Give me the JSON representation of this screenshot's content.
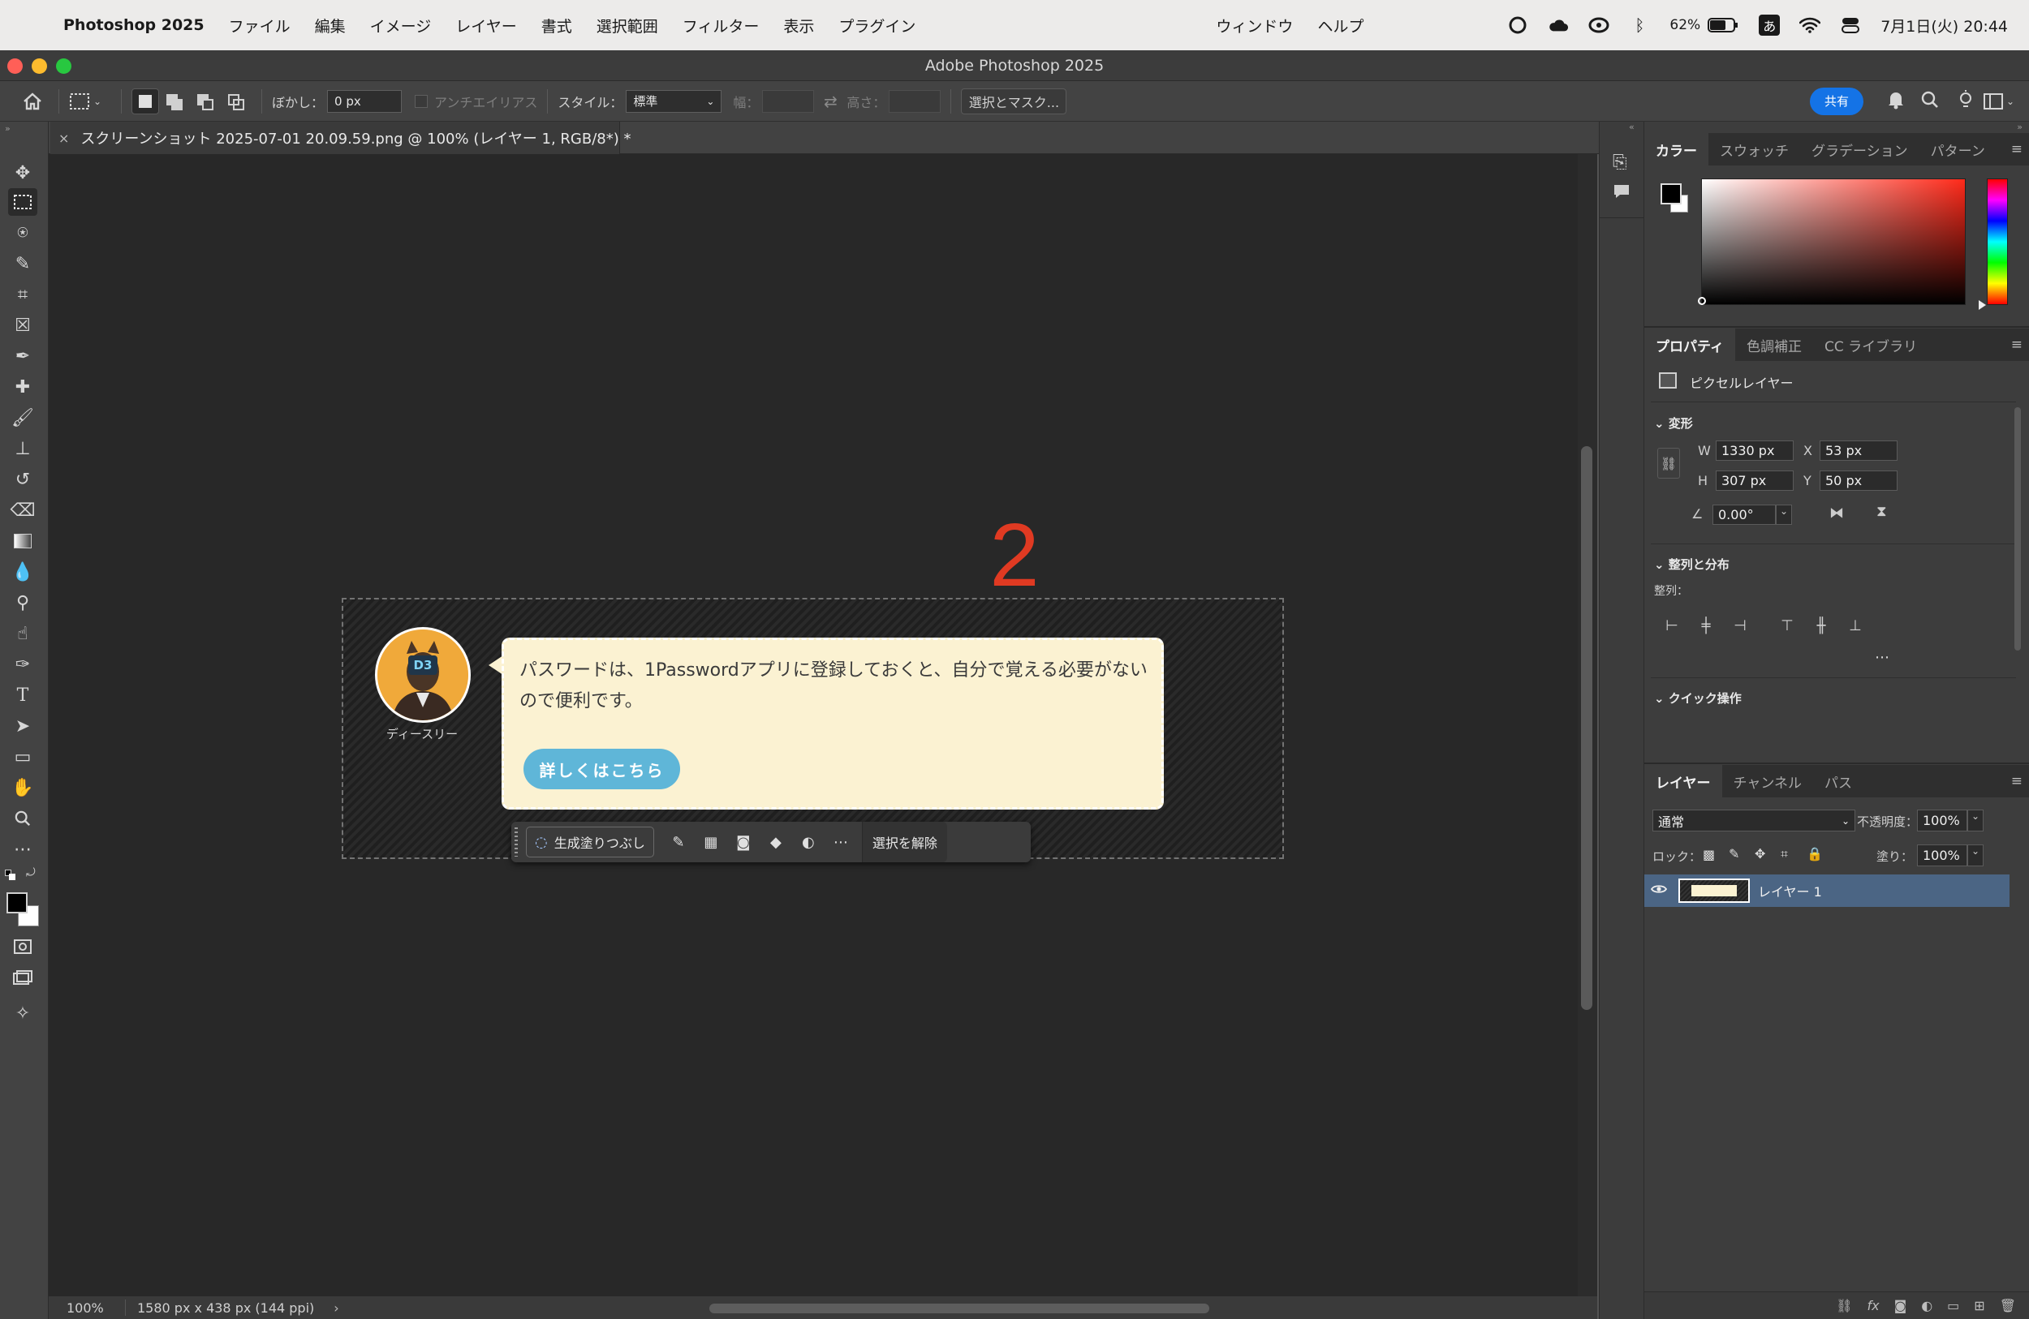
{
  "menubar": {
    "app_name": "Photoshop 2025",
    "items": [
      "ファイル",
      "編集",
      "イメージ",
      "レイヤー",
      "書式",
      "選択範囲",
      "フィルター",
      "表示",
      "プラグイン",
      "ウィンドウ",
      "ヘルプ"
    ],
    "battery": "62%",
    "ime": "あ",
    "clock": "7月1日(火)  20:44"
  },
  "window": {
    "title": "Adobe Photoshop 2025"
  },
  "options_bar": {
    "feather_label": "ぼかし：",
    "feather_value": "0 px",
    "antialias_label": "アンチエイリアス",
    "style_label": "スタイル：",
    "style_value": "標準",
    "width_label": "幅：",
    "height_label": "高さ：",
    "select_mask_label": "選択とマスク...",
    "share_label": "共有"
  },
  "document": {
    "tab_title": "スクリーンショット 2025-07-01 20.09.59.png @ 100% (レイヤー 1, RGB/8*) *"
  },
  "canvas": {
    "step_marker": "2",
    "avatar_badge": "D3",
    "avatar_name": "ディースリー",
    "bubble_text": "パスワードは、1Passwordアプリに登録しておくと、自分で覚える必要がないので便利です。",
    "bubble_button": "詳しくはこちら"
  },
  "context_bar": {
    "generative_fill": "生成塗りつぶし",
    "deselect": "選択を解除"
  },
  "status_bar": {
    "zoom": "100%",
    "doc_info": "1580 px x 438 px (144 ppi)"
  },
  "color_panel": {
    "tabs": [
      "カラー",
      "スウォッチ",
      "グラデーション",
      "パターン"
    ]
  },
  "properties_panel": {
    "tabs": [
      "プロパティ",
      "色調補正",
      "CC ライブラリ"
    ],
    "layer_kind": "ピクセルレイヤー",
    "transform_heading": "変形",
    "w_label": "W",
    "w_value": "1330 px",
    "h_label": "H",
    "h_value": "307 px",
    "x_label": "X",
    "x_value": "53 px",
    "y_label": "Y",
    "y_value": "50 px",
    "angle_value": "0.00°",
    "align_heading": "整列と分布",
    "align_label": "整列：",
    "quick_actions_heading": "クイック操作"
  },
  "layers_panel": {
    "tabs": [
      "レイヤー",
      "チャンネル",
      "パス"
    ],
    "blend_mode": "通常",
    "opacity_label": "不透明度：",
    "opacity_value": "100%",
    "lock_label": "ロック：",
    "fill_label": "塗り：",
    "fill_value": "100%",
    "layers": [
      {
        "name": "レイヤー 1"
      }
    ]
  },
  "colors": {
    "accent_blue": "#1473e6",
    "marker_red": "#e03a22",
    "bubble_bg": "#fbf2d2",
    "bubble_button": "#5fb6d8",
    "selected_layer": "#4b6584"
  }
}
